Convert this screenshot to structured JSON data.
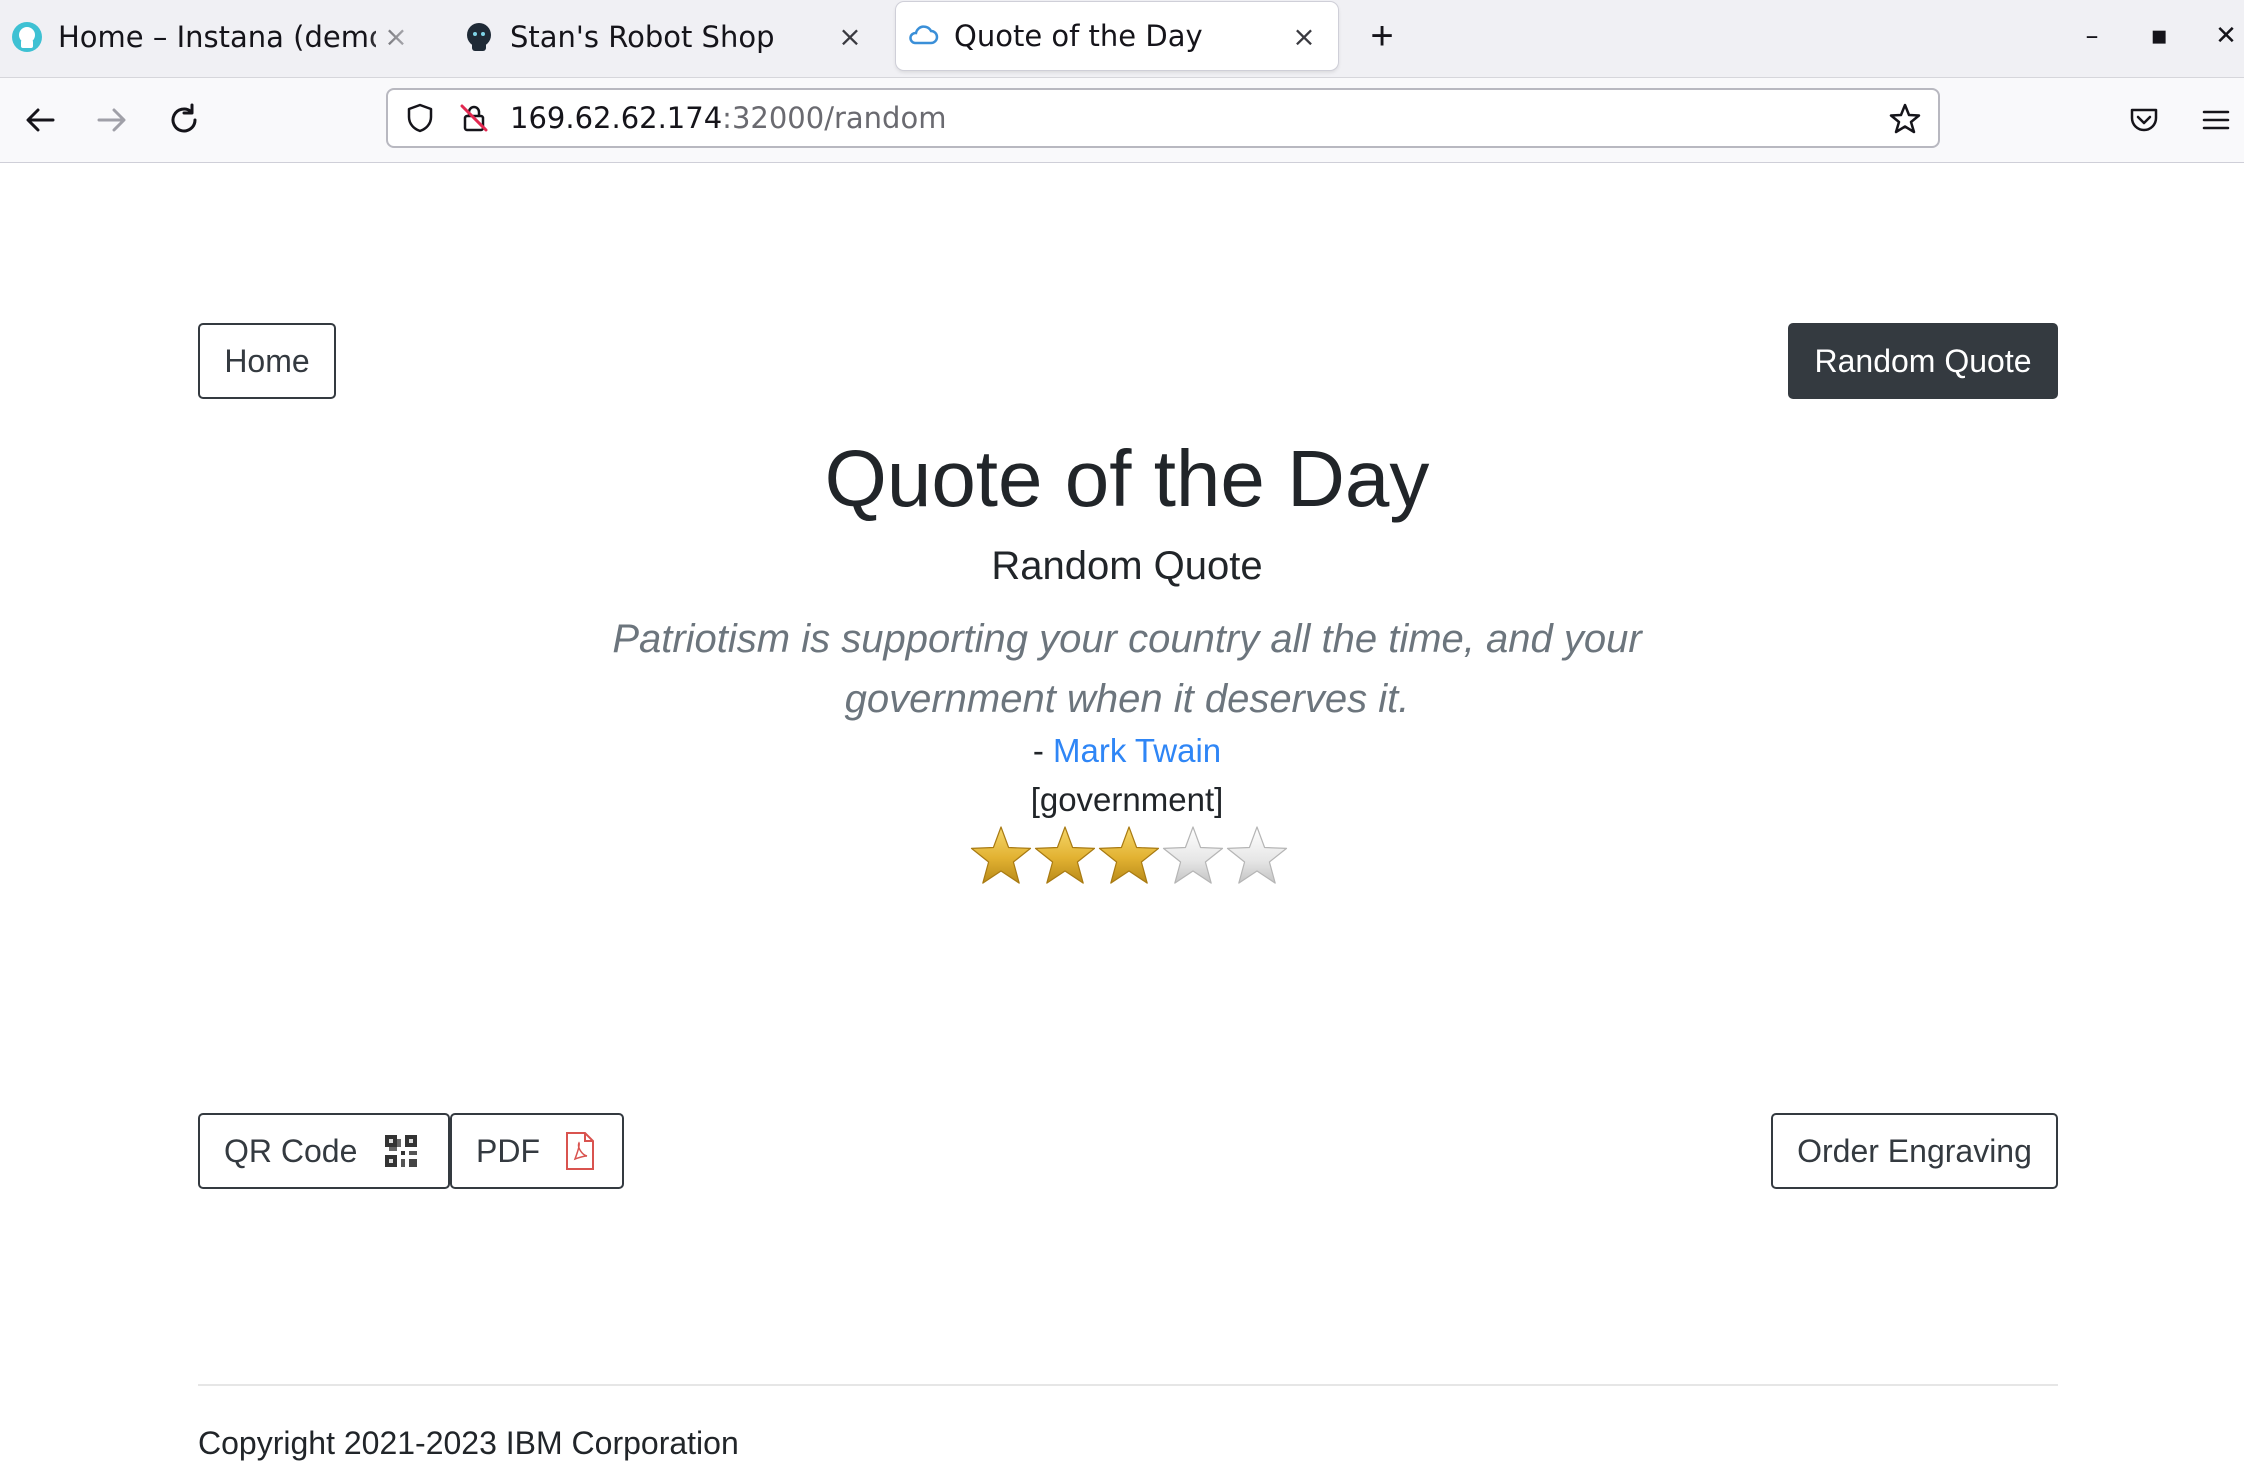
{
  "browser": {
    "tabs": [
      {
        "title": "Home – Instana (demolab",
        "favicon": "instana-icon"
      },
      {
        "title": "Stan's Robot Shop",
        "favicon": "robot-icon"
      },
      {
        "title": "Quote of the Day",
        "favicon": "cloud-icon",
        "active": true
      }
    ],
    "close_glyph": "×",
    "new_tab_glyph": "+",
    "url": {
      "host": "169.62.62.174",
      "path": ":32000/random"
    },
    "window_controls": {
      "minimize": "–",
      "maximize": "▪",
      "close": "✕"
    }
  },
  "nav": {
    "home_label": "Home",
    "random_label": "Random Quote"
  },
  "content": {
    "title": "Quote of the Day",
    "subtitle": "Random Quote",
    "quote_line1": "Patriotism is supporting your country all the time, and your",
    "quote_line2": "government when it deserves it.",
    "author_prefix": "- ",
    "author": "Mark Twain",
    "tags": "[government]",
    "rating": 3,
    "rating_max": 5
  },
  "actions": {
    "qr_label": "QR Code",
    "pdf_label": "PDF",
    "engraving_label": "Order Engraving"
  },
  "footer": {
    "copyright": "Copyright 2021-2023 IBM Corporation"
  },
  "colors": {
    "dark_button": "#343a40",
    "link": "#2f86f6",
    "star_filled": "#e8b935",
    "star_empty": "#e0e0e0"
  }
}
